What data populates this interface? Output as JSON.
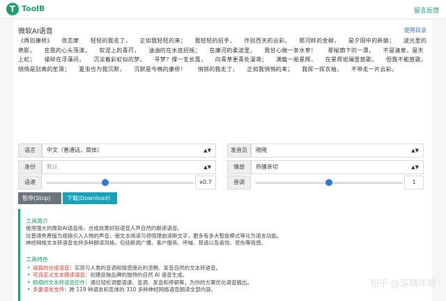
{
  "app": {
    "logo_letter": "T",
    "name": "ToolB",
    "feedback": "留言反馈"
  },
  "page": {
    "title": "微软AI语音",
    "lyrics_link": "使用目录"
  },
  "text_input": {
    "value": "《再别康桥》　　徐志摩　　轻轻的我走了，　　正如我轻轻的来；　　我轻轻的招手，　　作别西天的云彩。　　那河畔的金柳，　　是夕阳中的新娘；　　波光里的艳影，　　在我的心头荡漾。　　软泥上的青荇，　　油油的在水底招摇；　　在康河的柔波里，　　我甘心做一条水草！　　那榆荫下的一潭，　　不是清泉，是天上虹；　　揉碎在浮藻间，　　沉淀着彩虹似的梦。　　寻梦？撑一支长篙，　　向青草更青处漫溯；　　满载一船星辉，　　在星辉斑斓里放歌。　　但我不能放歌，　　悄悄是别离的笙箫；　　夏虫也为我沉默，　　沉默是今晚的康桥！　　悄悄的我走了，　　正如我悄悄的来；　　我挥一挥衣袖，　　不带走一片云彩。"
  },
  "settings": {
    "language": {
      "label": "语言",
      "value": "中文（普通话，简体）"
    },
    "voice": {
      "label": "发音员",
      "value": "晓晓"
    },
    "identity": {
      "label": "身份",
      "value": "默认"
    },
    "emotion": {
      "label": "情感",
      "value": "热情亲切"
    },
    "speed": {
      "label": "语速",
      "value": "x0.7",
      "level": 0.4
    },
    "pitch": {
      "label": "音调",
      "value": "1",
      "level": 0.5
    }
  },
  "buttons": {
    "stop": "暂停(Stop) ⦿",
    "download": "下载(Download) ⇪"
  },
  "intro": {
    "title": "工具简介",
    "lines": [
      "使用强大的微软AI语音库，合成效果好拟语音人声自然的朗读语音。",
      "比普通免费版为规格引入人物的声音，使文本阅读与领悟理由清晰文字，更多有多大智能模式等化为语言功能。",
      "神经网络文本转语音支持多种朗读风格，包括新闻广播、客户服务、呼喊、耳语以及喜悦、悲伤等情感。"
    ],
    "features_title": "工具特色",
    "features": [
      {
        "key": "逼真的合成语音",
        "text": "：实现与人类的音调和情感接近的流畅、发音自然的文本转语音。"
      },
      {
        "key": "可自定义文本朗读语音",
        "text": "：创建反映品牌的独特的自然 AI 语音生成。"
      },
      {
        "key": "精细的文本转语音控件",
        "text": "：通过轻松调整语速、音调、发音和停顿等，为你的方案优化语音输出。"
      },
      {
        "key": "多重语言支持",
        "text": "：跨 119 种语言和变体的 310 多种神经网络语音朗读全部内容。"
      }
    ]
  },
  "watermark": "知乎 @深耦年哥"
}
